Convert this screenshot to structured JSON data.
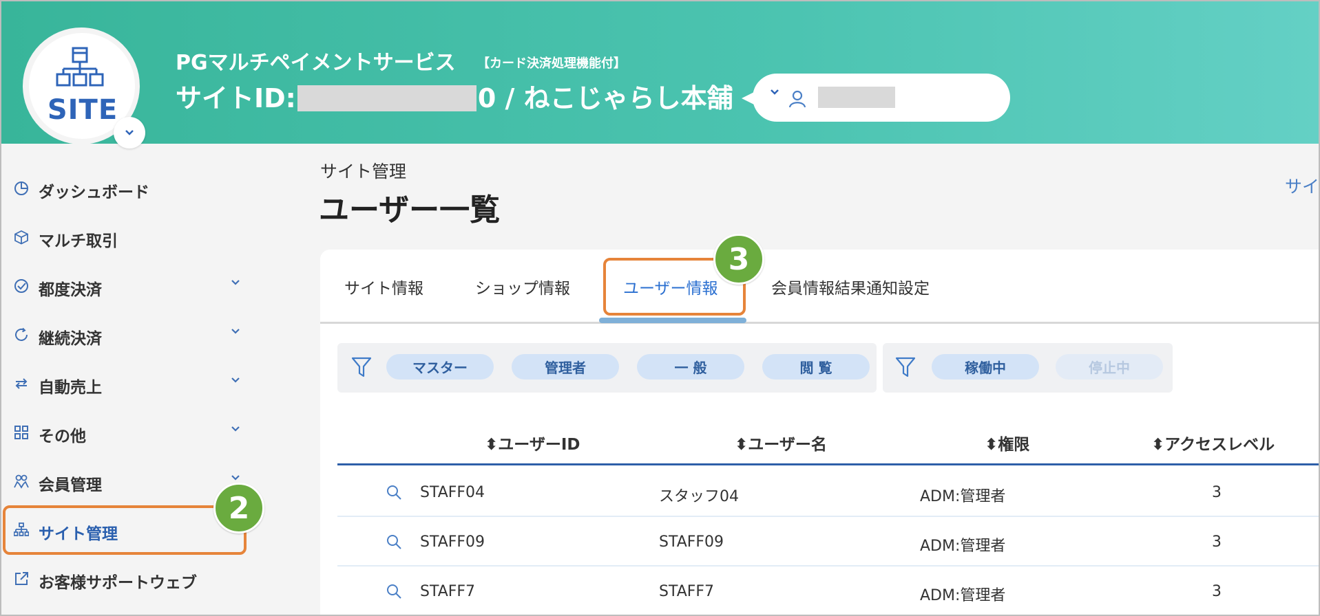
{
  "header": {
    "logo_text": "SITE",
    "service_name": "PGマルチペイメントサービス",
    "service_note": "【カード決済処理機能付】",
    "site_id_prefix": "サイトID:",
    "site_id_suffix": "0 / ねこじゃらし本舗"
  },
  "sidebar": {
    "items": [
      {
        "label": "ダッシュボード",
        "icon": "pie-chart-icon"
      },
      {
        "label": "マルチ取引",
        "icon": "cube-icon"
      },
      {
        "label": "都度決済",
        "icon": "check-circle-icon"
      },
      {
        "label": "継続決済",
        "icon": "refresh-icon"
      },
      {
        "label": "自動売上",
        "icon": "swap-icon"
      },
      {
        "label": "その他",
        "icon": "grid-icon"
      },
      {
        "label": "会員管理",
        "icon": "users-icon"
      },
      {
        "label": "サイト管理",
        "icon": "sitemap-icon"
      },
      {
        "label": "お客様サポートウェブ",
        "icon": "external-link-icon"
      }
    ]
  },
  "annotations": {
    "badge_2": "2",
    "badge_3": "3"
  },
  "main": {
    "breadcrumb": "サイト管理",
    "title": "ユーザー一覧",
    "right_link": "サイ",
    "tabs": [
      "サイト情報",
      "ショップ情報",
      "ユーザー情報",
      "会員情報結果通知設定"
    ],
    "role_filters": [
      "マスター",
      "管理者",
      "一 般",
      "閲 覧"
    ],
    "status_filters": [
      "稼働中",
      "停止中"
    ],
    "columns": [
      "ユーザーID",
      "ユーザー名",
      "権限",
      "アクセスレベル"
    ],
    "rows": [
      {
        "id": "STAFF04",
        "name": "スタッフ04",
        "role": "ADM:管理者",
        "level": "3"
      },
      {
        "id": "STAFF09",
        "name": "STAFF09",
        "role": "ADM:管理者",
        "level": "3"
      },
      {
        "id": "STAFF7",
        "name": "STAFF7",
        "role": "ADM:管理者",
        "level": "3"
      }
    ]
  },
  "colors": {
    "header_start": "#38b59a",
    "header_end": "#64d0c5",
    "accent_blue": "#2a5fae",
    "highlight_orange": "#e6843a",
    "badge_green": "#6aab3f"
  }
}
